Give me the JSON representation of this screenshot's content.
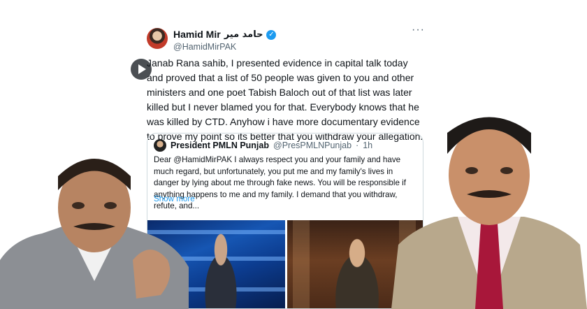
{
  "tweet": {
    "display_name": "Hamid Mir",
    "display_name_urdu": "حامد میر",
    "verified_icon": "verified-badge-icon",
    "handle": "@HamidMirPAK",
    "more_icon": "more-options-icon",
    "text": "Janab Rana sahib, I presented evidence in capital talk today and proved that a list of 50 people was given to you and other ministers and one poet Tabish Baloch out of that list was later killed but I never blamed you for that. Everybody knows that he was killed by CTD. Anyhow i have more documentary evidence to prove my point so its better that you withdraw your allegation."
  },
  "quoted": {
    "display_name": "President PMLN Punjab",
    "handle": "@PresPMLNPunjab",
    "separator": "·",
    "time": "1h",
    "text": "Dear @HamidMirPAK I always respect you and your family and have much regard, but unfortunately, you put me and my family's lives in danger by lying about me through fake news. You will be responsible if anything happens to me and my family. I demand that you withdraw, refute, and...",
    "show_more": "Show more",
    "play_icon": "play-icon"
  },
  "colors": {
    "link": "#1d9bf0",
    "text": "#0f1419",
    "secondary": "#536471",
    "border": "#cfd9de"
  }
}
